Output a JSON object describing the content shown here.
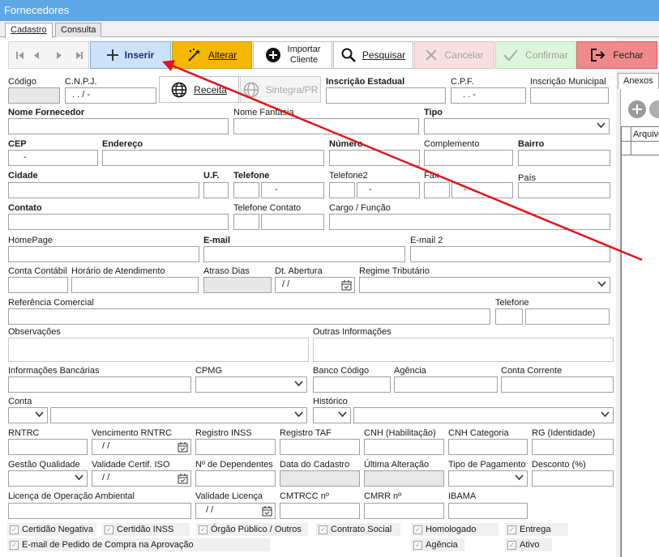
{
  "window": {
    "title": "Fornecedores"
  },
  "tabs": [
    {
      "label": "Cadastro"
    },
    {
      "label": "Consulta"
    }
  ],
  "toolbar": {
    "insert": "Inserir",
    "edit": "Alterar",
    "import_line1": "Importar",
    "import_line2": "Cliente",
    "search": "Pesquisar",
    "cancel": "Cancelar",
    "confirm": "Confirmar",
    "close": "Fechar",
    "colors": {
      "insert": "#cde2f8",
      "edit": "#f5b800",
      "cancel": "#f9e0e0",
      "confirm": "#dcf5dc",
      "close": "#f08a8a"
    }
  },
  "side_panel": {
    "tab": "Anexos",
    "column": "Arquivo"
  },
  "buttons": {
    "receita": "Receita",
    "sintegra": "Sintegra/PR"
  },
  "labels": {
    "codigo": "Código",
    "cnpj": "C.N.P.J.",
    "ie": "Inscrição Estadual",
    "cpf": "C.P.F.",
    "im": "Inscrição Municipal",
    "nome": "Nome Fornecedor",
    "fantasia": "Nome Fantasia",
    "tipo": "Tipo",
    "cep": "CEP",
    "endereco": "Endereço",
    "numero": "Número",
    "complemento": "Complemento",
    "bairro": "Bairro",
    "cidade": "Cidade",
    "uf": "U.F.",
    "telefone": "Telefone",
    "telefone2": "Telefone2",
    "fax": "Fax",
    "pais": "País",
    "contato": "Contato",
    "tel_contato": "Telefone Contato",
    "cargo": "Cargo / Função",
    "homepage": "HomePage",
    "email": "E-mail",
    "email2": "E-mail 2",
    "conta_contabil": "Conta Contábil",
    "horario": "Horário de Atendimento",
    "atraso": "Atraso Dias",
    "dt_abertura": "Dt. Abertura",
    "regime": "Regime Tributário",
    "ref_comercial": "Referência Comercial",
    "telefone_ref": "Telefone",
    "observacoes": "Observações",
    "outras_info": "Outras Informações",
    "info_bancarias": "Informações Bancárias",
    "cpmg": "CPMG",
    "banco_codigo": "Banco Código",
    "agencia": "Agência",
    "conta_corrente": "Conta Corrente",
    "conta": "Conta",
    "historico": "Histórico",
    "rntrc": "RNTRC",
    "venc_rntrc": "Vencimento RNTRC",
    "reg_inss": "Registro INSS",
    "reg_taf": "Registro TAF",
    "cnh": "CNH (Habilitação)",
    "cnh_cat": "CNH Categoria",
    "rg": "RG (Identidade)",
    "gestao": "Gestão Qualidade",
    "val_iso": "Validade Certif. ISO",
    "dependentes": "Nº de Dependentes",
    "data_cadastro": "Data do Cadastro",
    "ultima_alt": "Última Alteração",
    "tipo_pgto": "Tipo de Pagamento",
    "desconto": "Desconto (%)",
    "licenca": "Licença de Operação Ambiental",
    "val_licenca": "Validade Licença",
    "cmtrcc": "CMTRCC nº",
    "cmrr": "CMRR nº",
    "ibama": "IBAMA"
  },
  "masks": {
    "cnpj": ".   .   /   -",
    "cpf": ".   .   -",
    "cep": "-",
    "phone": "-",
    "date": "/  /"
  },
  "checkboxes": {
    "certidao_negativa": "Certidão Negativa",
    "certidao_inss": "Certidão INSS",
    "orgao_publico": "Órgão Público / Outros",
    "contrato_social": "Contrato Social",
    "homologado": "Homologado",
    "entrega": "Entrega",
    "email_pedido": "E-mail de Pedido de Compra na Aprovação",
    "agencia": "Agência",
    "ativo": "Ativo",
    "check_mark": "✓"
  }
}
